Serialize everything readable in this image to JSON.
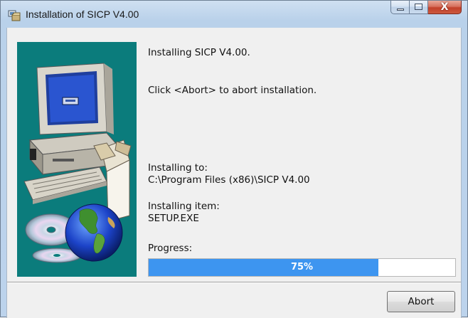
{
  "window": {
    "title": "Installation of SICP V4.00",
    "controls": {
      "minimize": "minimize",
      "maximize": "maximize",
      "close": "X"
    }
  },
  "messages": {
    "installing": "Installing SICP V4.00.",
    "abort_hint": "Click <Abort> to abort installation."
  },
  "install_to": {
    "label": "Installing to:",
    "path": "C:\\Program Files (x86)\\SICP V4.00"
  },
  "install_item": {
    "label": "Installing item:",
    "value": "SETUP.EXE"
  },
  "progress": {
    "label": "Progress:",
    "percent": 75,
    "text": "75%"
  },
  "buttons": {
    "abort": "Abort"
  },
  "icons": [
    "installer-app-icon",
    "computer-icon",
    "cd-disc-icon",
    "globe-icon"
  ],
  "colors": {
    "art_background": "#0b7c7c",
    "progress_fill": "#3d95f0"
  }
}
